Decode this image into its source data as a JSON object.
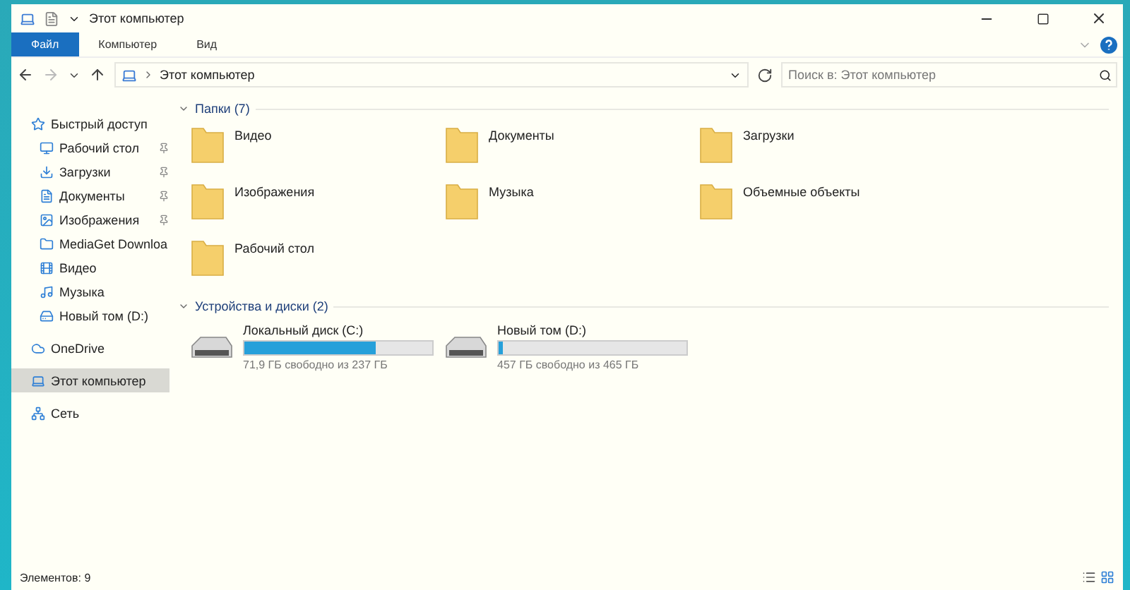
{
  "window": {
    "title": "Этот компьютер"
  },
  "ribbon_tabs": [
    {
      "label": "Файл",
      "selected": true
    },
    {
      "label": "Компьютер",
      "selected": false
    },
    {
      "label": "Вид",
      "selected": false
    }
  ],
  "address_bar": {
    "path": "Этот компьютер"
  },
  "search": {
    "placeholder": "Поиск в: Этот компьютер"
  },
  "sidebar": {
    "items": [
      {
        "label": "Быстрый доступ",
        "selected": false,
        "children": [
          {
            "label": "Рабочий стол",
            "pinned": true
          },
          {
            "label": "Загрузки",
            "pinned": true
          },
          {
            "label": "Документы",
            "pinned": true
          },
          {
            "label": "Изображения",
            "pinned": true
          },
          {
            "label": "MediaGet Downloa",
            "pinned": false
          },
          {
            "label": "Видео",
            "pinned": false
          },
          {
            "label": "Музыка",
            "pinned": false
          },
          {
            "label": "Новый том (D:)",
            "pinned": false
          }
        ]
      },
      {
        "label": "OneDrive",
        "selected": false
      },
      {
        "label": "Этот компьютер",
        "selected": true
      },
      {
        "label": "Сеть",
        "selected": false
      }
    ]
  },
  "folders": {
    "heading": "Папки (7)",
    "items": [
      "Видео",
      "Документы",
      "Загрузки",
      "Изображения",
      "Музыка",
      "Объемные объекты",
      "Рабочий стол"
    ]
  },
  "drives": {
    "heading": "Устройства и диски (2)",
    "items": [
      {
        "name": "Локальный диск (C:)",
        "level": 0.7,
        "free": "71,9 ГБ свободно из 237 ГБ"
      },
      {
        "name": "Новый том (D:)",
        "level": 0.02,
        "free": "457 ГБ свободно из 465 ГБ"
      }
    ]
  },
  "status_bar": {
    "text": "Элементов: 9"
  }
}
